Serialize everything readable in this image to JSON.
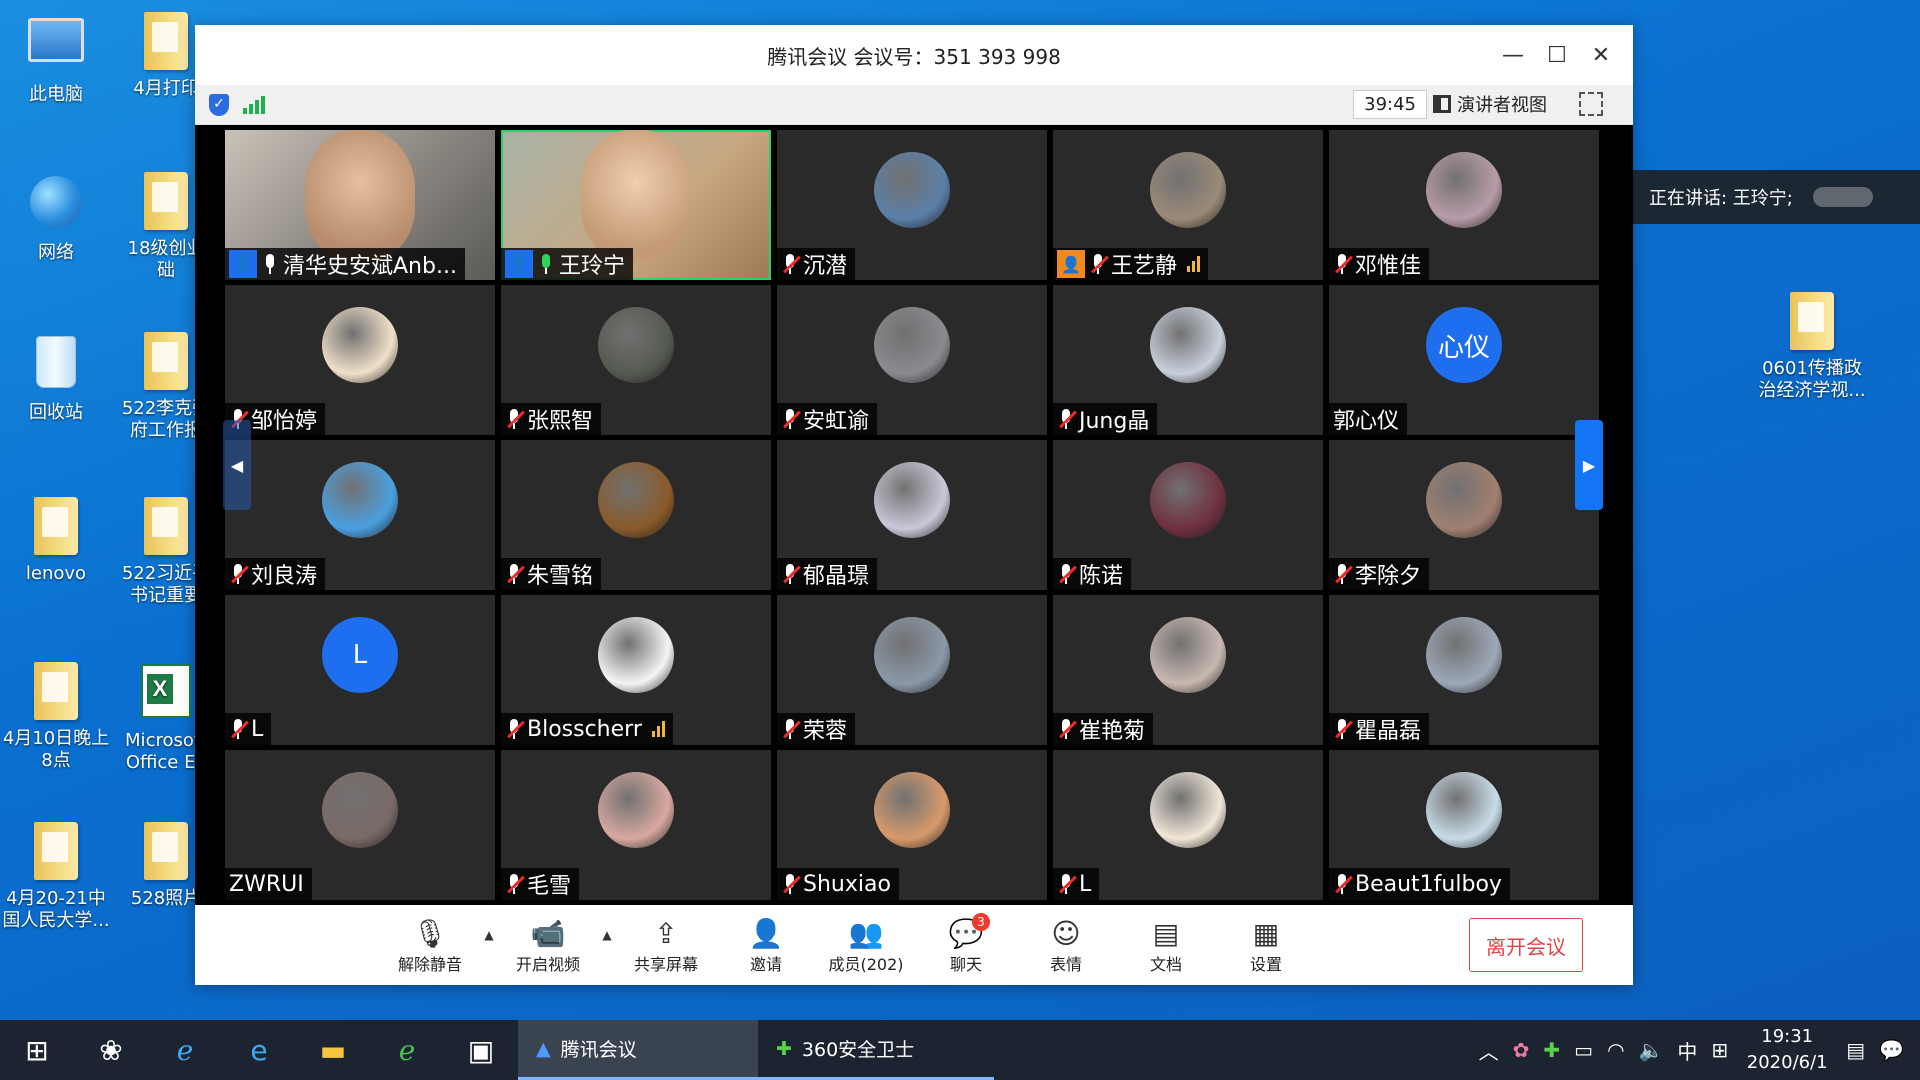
{
  "desktop": {
    "icons": [
      {
        "label": "此电脑",
        "type": "pc"
      },
      {
        "label": "4月打印",
        "type": "folder"
      },
      {
        "label": "网络",
        "type": "globe"
      },
      {
        "label": "18级创业\n础",
        "type": "folder"
      },
      {
        "label": "回收站",
        "type": "bin"
      },
      {
        "label": "522李克强\n府工作报",
        "type": "folder"
      },
      {
        "label": "lenovo",
        "type": "folder"
      },
      {
        "label": "522习近平\n书记重要",
        "type": "folder"
      },
      {
        "label": "4月10日晚上\n8点",
        "type": "folder"
      },
      {
        "label": "Microsoft\nOffice Ex",
        "type": "excel"
      },
      {
        "label": "4月20-21中\n国人民大学...",
        "type": "folder"
      },
      {
        "label": "528照片",
        "type": "folder"
      },
      {
        "label": "0601传播政\n治经济学视...",
        "type": "folder"
      }
    ]
  },
  "window": {
    "title": "腾讯会议 会议号：351 393 998",
    "timer": "39:45",
    "presenter_view": "演讲者视图"
  },
  "participants": [
    {
      "name": "清华史安斌Anb...",
      "mic": "on",
      "host": "blue",
      "video": "video1"
    },
    {
      "name": "王玲宁",
      "mic": "on-green",
      "host": "blue",
      "video": "video2"
    },
    {
      "name": "沉潜",
      "mic": "muted",
      "avatar_color": "#5b7fa8"
    },
    {
      "name": "王艺静",
      "mic": "muted",
      "host": "orange",
      "avatar_color": "#9a8a78",
      "bars": true
    },
    {
      "name": "邓惟佳",
      "mic": "muted",
      "avatar_color": "#b89ba8"
    },
    {
      "name": "邹怡婷",
      "mic": "muted",
      "avatar_color": "#f0e0c8"
    },
    {
      "name": "张熙智",
      "mic": "muted",
      "avatar_color": "#555a50"
    },
    {
      "name": "安虹谕",
      "mic": "muted",
      "avatar_color": "#8a8a90"
    },
    {
      "name": "Jung晶",
      "mic": "muted",
      "avatar_color": "#c8d0dc"
    },
    {
      "name": "郭心仪",
      "mic": "none",
      "avatar_letter": "心仪",
      "avatar_color": "#1e6ff0"
    },
    {
      "name": "刘良涛",
      "mic": "muted",
      "avatar_color": "#4aa0e0"
    },
    {
      "name": "朱雪铭",
      "mic": "muted",
      "avatar_color": "#8a5a2a"
    },
    {
      "name": "郁晶璟",
      "mic": "muted",
      "avatar_color": "#c8c8d8"
    },
    {
      "name": "陈诺",
      "mic": "muted",
      "avatar_color": "#703040"
    },
    {
      "name": "李除夕",
      "mic": "muted",
      "avatar_color": "#a08070"
    },
    {
      "name": "L",
      "mic": "muted",
      "avatar_letter": "L",
      "avatar_color": "#1e6ff0"
    },
    {
      "name": "Blosscherr",
      "mic": "muted",
      "avatar_color": "#f4f4f4",
      "bars": true
    },
    {
      "name": "荣蓉",
      "mic": "muted",
      "avatar_color": "#8a98a8"
    },
    {
      "name": "崔艳菊",
      "mic": "muted",
      "avatar_color": "#c8b8b0"
    },
    {
      "name": "瞿晶磊",
      "mic": "muted",
      "avatar_color": "#9ca8b8"
    },
    {
      "name": "ZWRUI",
      "mic": "none",
      "avatar_color": "#7a6a66"
    },
    {
      "name": "毛雪",
      "mic": "muted",
      "avatar_color": "#d8a8a0"
    },
    {
      "name": "Shuxiao",
      "mic": "muted",
      "avatar_color": "#d89a6a"
    },
    {
      "name": "L",
      "mic": "muted",
      "avatar_color": "#f0e6d8"
    },
    {
      "name": "Beaut1fulboy",
      "mic": "muted",
      "avatar_color": "#c8dce8"
    }
  ],
  "speaking": "正在讲话: 王玲宁;",
  "toolbar": {
    "unmute": "解除静音",
    "video": "开启视频",
    "share": "共享屏幕",
    "invite": "邀请",
    "members": "成员(202)",
    "chat": "聊天",
    "chat_badge": "3",
    "emoji": "表情",
    "docs": "文档",
    "settings": "设置",
    "leave": "离开会议"
  },
  "taskbar": {
    "apps": [
      {
        "label": "腾讯会议",
        "state": "active"
      },
      {
        "label": "360安全卫士",
        "state": "open"
      }
    ],
    "ime": "中",
    "time": "19:31",
    "date": "2020/6/1",
    "notif_count": "1"
  }
}
